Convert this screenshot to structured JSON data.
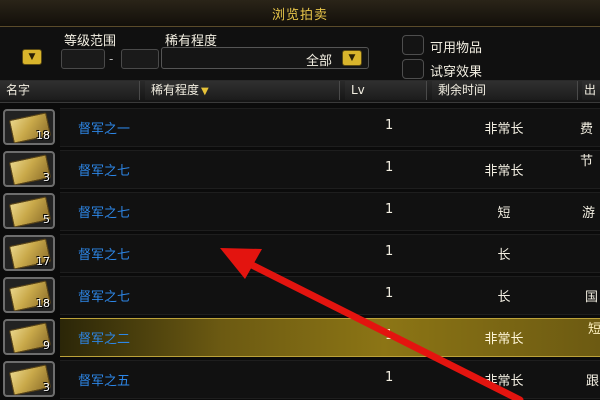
{
  "window": {
    "title": "浏览拍卖"
  },
  "filters": {
    "level_range_label": "等级范围",
    "level_separator": "-",
    "rarity_label": "稀有程度",
    "rarity_value": "全部",
    "usable_items_label": "可用物品",
    "try_on_label": "试穿效果"
  },
  "columns": {
    "name": "名字",
    "rarity": "稀有程度",
    "level": "Lv",
    "time_left": "剩余时间",
    "seller": "出"
  },
  "rows": [
    {
      "count": "18",
      "name": "督军之一",
      "level": "1",
      "time_left": "非常长",
      "seller": "费",
      "selected": false
    },
    {
      "count": "3",
      "name": "督军之七",
      "level": "1",
      "time_left": "非常长",
      "seller": "节",
      "selected": false
    },
    {
      "count": "5",
      "name": "督军之七",
      "level": "1",
      "time_left": "短",
      "seller": "游",
      "selected": false
    },
    {
      "count": "17",
      "name": "督军之七",
      "level": "1",
      "time_left": "长",
      "seller": "",
      "selected": false
    },
    {
      "count": "18",
      "name": "督军之七",
      "level": "1",
      "time_left": "长",
      "seller": "国",
      "selected": false
    },
    {
      "count": "9",
      "name": "督军之二",
      "level": "1",
      "time_left": "非常长",
      "seller": "短",
      "selected": true
    },
    {
      "count": "3",
      "name": "督军之五",
      "level": "1",
      "time_left": "非常长",
      "seller": "跟",
      "selected": false
    }
  ],
  "colors": {
    "accent": "#e8c64a",
    "item_name": "#2d86e6",
    "selected_row": "#8c7515",
    "annotation_arrow": "#e3140f"
  }
}
